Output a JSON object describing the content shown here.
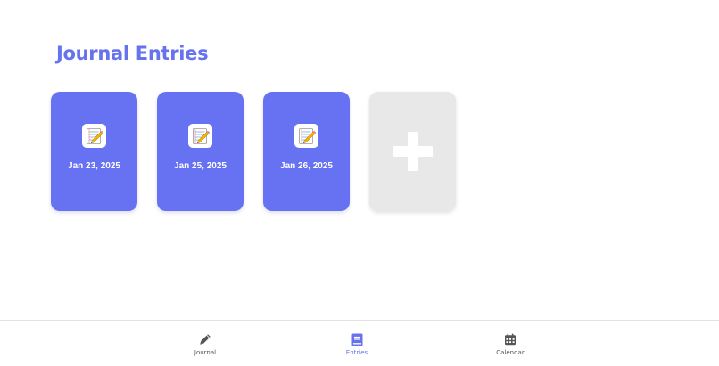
{
  "page": {
    "title": "Journal Entries"
  },
  "entries": [
    {
      "date": "Jan 23, 2025",
      "icon": "notepad-pencil-icon"
    },
    {
      "date": "Jan 25, 2025",
      "icon": "notepad-pencil-icon"
    },
    {
      "date": "Jan 26, 2025",
      "icon": "notepad-pencil-icon"
    }
  ],
  "add_card": {
    "icon": "plus-icon"
  },
  "nav": {
    "items": [
      {
        "label": "Journal",
        "icon": "pencil-icon",
        "active": false
      },
      {
        "label": "Entries",
        "icon": "book-icon",
        "active": true
      },
      {
        "label": "Calendar",
        "icon": "calendar-icon",
        "active": false
      }
    ]
  },
  "colors": {
    "accent": "#6672ee",
    "card": "#6672f2",
    "add_card": "#e8e8e8",
    "nav_text": "#555555"
  }
}
